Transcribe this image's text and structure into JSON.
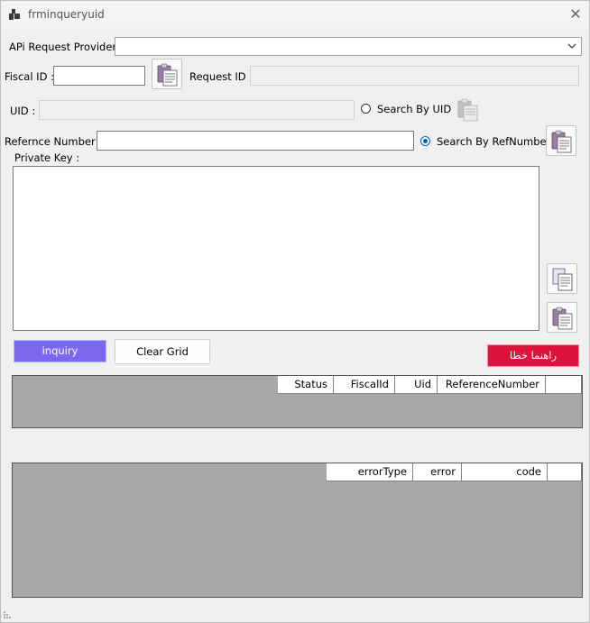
{
  "window": {
    "title": "frminqueryuid",
    "close_glyph": "✕"
  },
  "form": {
    "api_provider_label": "APi Request Provider :",
    "api_provider_value": "",
    "fiscal_id_label": "Fiscal ID :",
    "fiscal_id_value": "",
    "request_id_label": "Request ID :",
    "request_id_value": "",
    "uid_label": "UID :",
    "uid_value": "",
    "search_by_uid_label": "Search By UID",
    "reference_number_label": "Refernce Number :",
    "reference_number_value": "",
    "search_by_refnumber_label": "Search By RefNumber",
    "private_key_label": "Private Key :",
    "private_key_value": ""
  },
  "buttons": {
    "inquiry": "inquiry",
    "clear_grid": "Clear Grid",
    "error_guide": "راهنما خطا"
  },
  "results_grid": {
    "columns": [
      "Status",
      "FiscalId",
      "Uid",
      "ReferenceNumber"
    ]
  },
  "errors_grid": {
    "columns": [
      "errorType",
      "error",
      "code"
    ]
  },
  "colors": {
    "inquiry_bg": "#7b68ee",
    "error_guide_bg": "#dc143c",
    "grid_bg": "#a8a8a8",
    "radio_selected": "#0063b1"
  },
  "icons": [
    "window-app-icon",
    "close-icon",
    "clipboard-paste-icon",
    "chevron-down-icon",
    "copy-icon",
    "radio-icon",
    "size-grip-icon"
  ]
}
